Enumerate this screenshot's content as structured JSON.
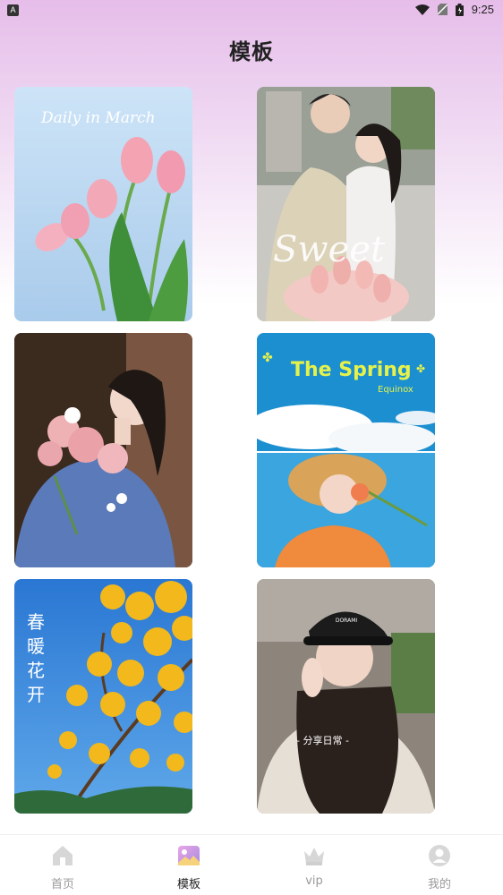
{
  "status_bar": {
    "notification_icon": "A",
    "time": "9:25",
    "icons": [
      "wifi-icon",
      "no-sim-icon",
      "battery-icon"
    ]
  },
  "page": {
    "title": "模板"
  },
  "templates": [
    {
      "id": "daily-march",
      "overlay_text": "Daily in March"
    },
    {
      "id": "sweet",
      "overlay_text": "Sweet"
    },
    {
      "id": "flowers-portrait",
      "overlay_text": ""
    },
    {
      "id": "spring-equinox",
      "overlay_text": "The Spring",
      "overlay_subtext": "Equinox"
    },
    {
      "id": "spring-blossom",
      "overlay_text": "春暖花开"
    },
    {
      "id": "share-daily",
      "overlay_text": "- 分享日常 -"
    }
  ],
  "tabbar": {
    "active": "templates",
    "items": [
      {
        "key": "home",
        "label": "首页",
        "icon": "home-icon"
      },
      {
        "key": "templates",
        "label": "模板",
        "icon": "picture-icon"
      },
      {
        "key": "vip",
        "label": "vip",
        "icon": "crown-icon"
      },
      {
        "key": "mine",
        "label": "我的",
        "icon": "user-icon"
      }
    ]
  },
  "colors": {
    "header_gradient_top": "#e6bde9",
    "accent_active": "#c98ad6",
    "inactive_icon": "#d4d4d4"
  }
}
